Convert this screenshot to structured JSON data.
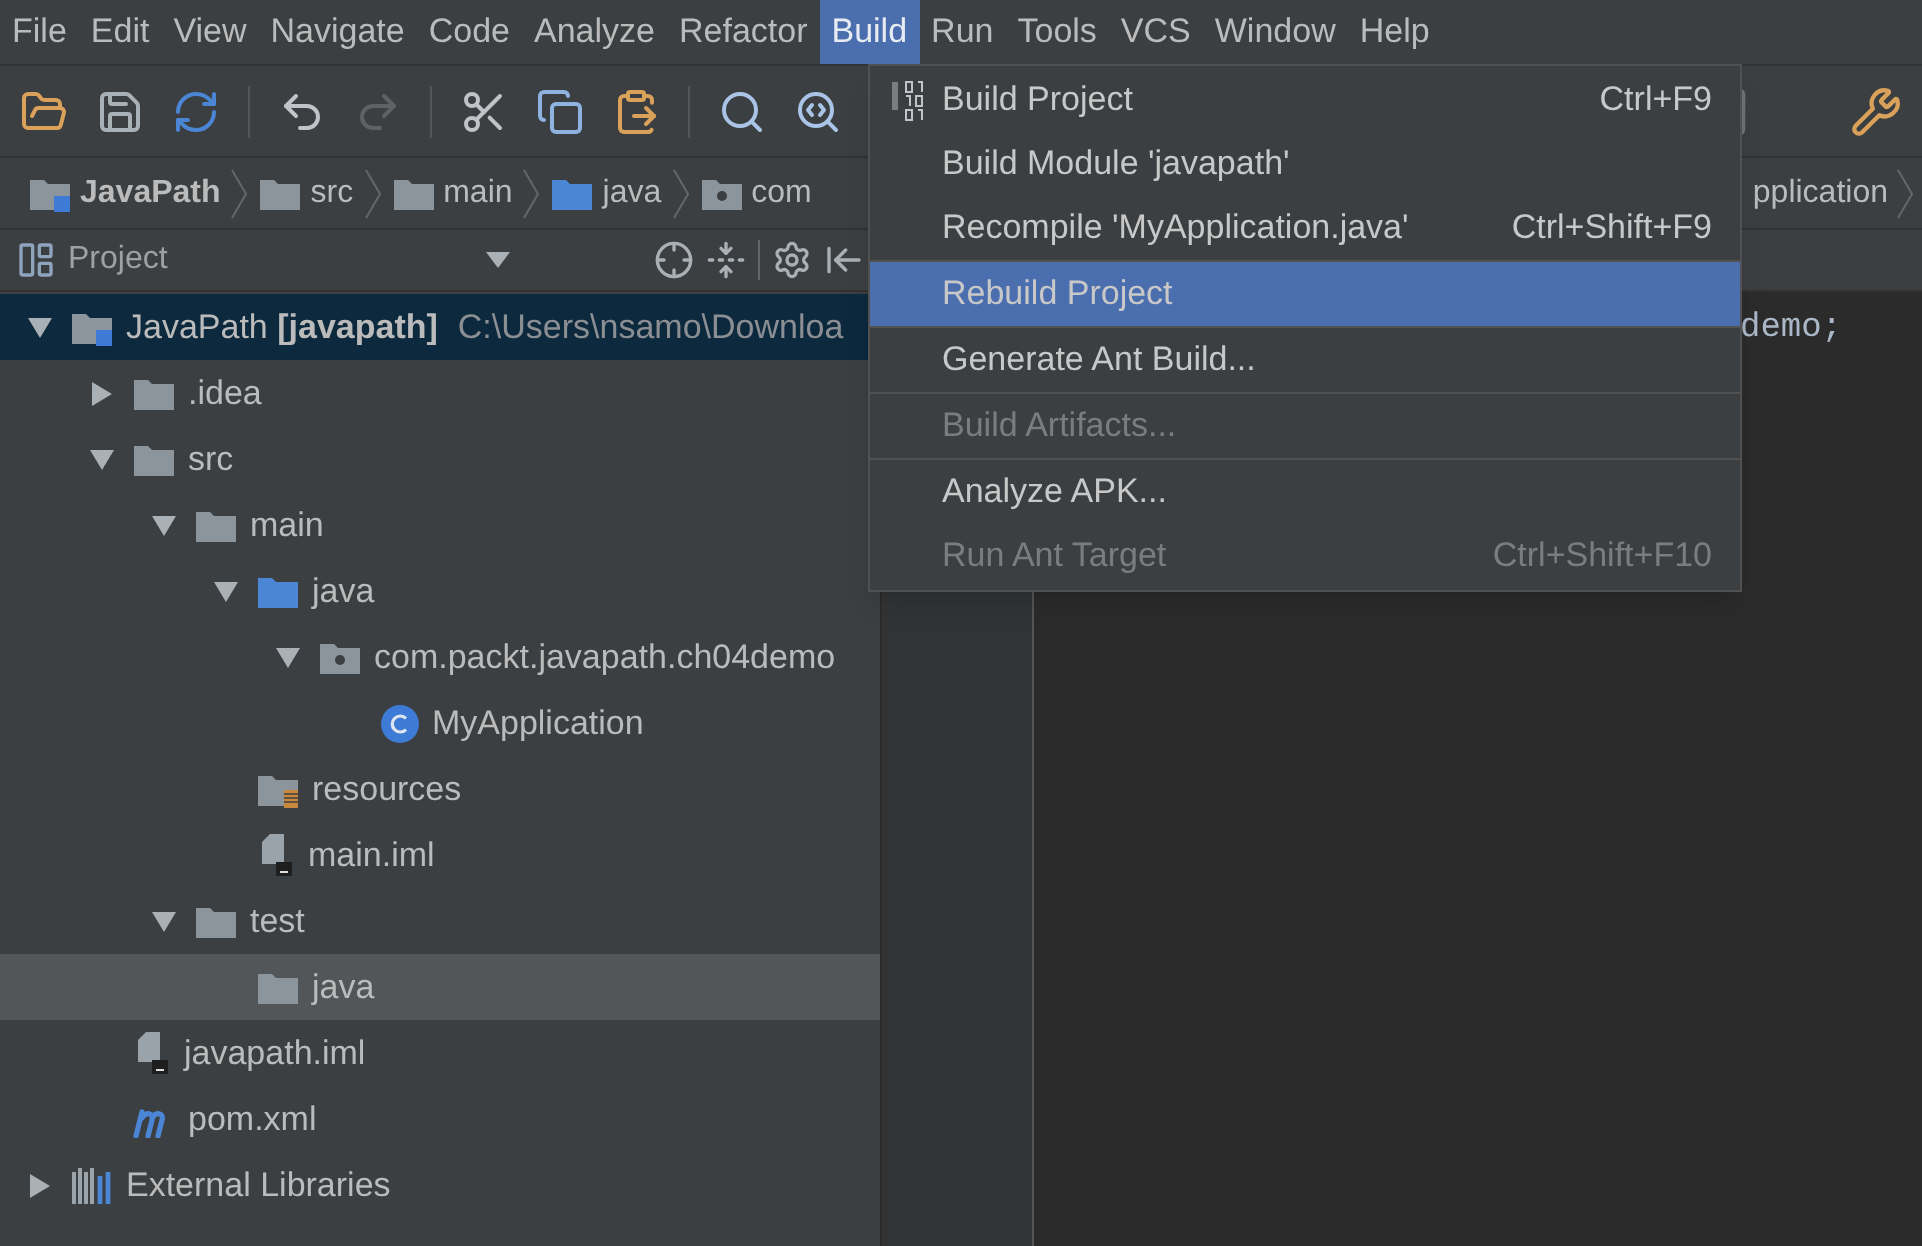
{
  "menu_bar": [
    {
      "label": "File",
      "selected": false
    },
    {
      "label": "Edit",
      "selected": false
    },
    {
      "label": "View",
      "selected": false
    },
    {
      "label": "Navigate",
      "selected": false
    },
    {
      "label": "Code",
      "selected": false
    },
    {
      "label": "Analyze",
      "selected": false
    },
    {
      "label": "Refactor",
      "selected": false
    },
    {
      "label": "Build",
      "selected": true
    },
    {
      "label": "Run",
      "selected": false
    },
    {
      "label": "Tools",
      "selected": false
    },
    {
      "label": "VCS",
      "selected": false
    },
    {
      "label": "Window",
      "selected": false
    },
    {
      "label": "Help",
      "selected": false
    }
  ],
  "breadcrumbs": [
    {
      "label": "JavaPath",
      "kind": "module"
    },
    {
      "label": "src",
      "kind": "folder"
    },
    {
      "label": "main",
      "kind": "folder"
    },
    {
      "label": "java",
      "kind": "source_folder"
    },
    {
      "label": "com",
      "kind": "package"
    }
  ],
  "breadcrumb_tail": "pplication",
  "project_panel": {
    "title": "Project",
    "tree": [
      {
        "label": "JavaPath **[javapath]**",
        "path": "C:\\Users\\nsamo\\Downloa",
        "kind": "module",
        "expanded": true,
        "selected": true,
        "hovered": false,
        "children": [
          {
            "label": ".idea",
            "kind": "folder",
            "expanded": false,
            "selected": false,
            "hovered": false
          },
          {
            "label": "src",
            "kind": "folder",
            "expanded": true,
            "selected": false,
            "hovered": false,
            "children": [
              {
                "label": "main",
                "kind": "folder",
                "expanded": true,
                "selected": false,
                "hovered": false,
                "children": [
                  {
                    "label": "java",
                    "kind": "source_folder",
                    "expanded": true,
                    "selected": false,
                    "hovered": false,
                    "children": [
                      {
                        "label": "com.packt.javapath.ch04demo",
                        "kind": "package",
                        "expanded": true,
                        "selected": false,
                        "hovered": false,
                        "children": [
                          {
                            "label": "MyApplication",
                            "kind": "class",
                            "selected": false,
                            "hovered": false
                          }
                        ]
                      }
                    ]
                  },
                  {
                    "label": "resources",
                    "kind": "resources_folder",
                    "selected": false,
                    "hovered": false
                  },
                  {
                    "label": "main.iml",
                    "kind": "module_file",
                    "selected": false,
                    "hovered": false
                  }
                ]
              },
              {
                "label": "test",
                "kind": "folder",
                "expanded": true,
                "selected": false,
                "hovered": false,
                "children": [
                  {
                    "label": "java",
                    "kind": "folder",
                    "selected": false,
                    "hovered": true
                  }
                ]
              }
            ]
          },
          {
            "label": "javapath.iml",
            "kind": "module_file",
            "selected": false,
            "hovered": false
          },
          {
            "label": "pom.xml",
            "kind": "maven_file",
            "selected": false,
            "hovered": false
          }
        ]
      },
      {
        "label": "External Libraries",
        "kind": "libraries",
        "expanded": false,
        "selected": false,
        "hovered": false
      }
    ]
  },
  "editor": {
    "code_line": "demo;"
  },
  "build_menu": {
    "groups": [
      [
        {
          "label": "Build Project",
          "shortcut": "Ctrl+F9",
          "disabled": false,
          "selected": false,
          "kind": "binary"
        },
        {
          "label": "Build Module 'javapath'",
          "disabled": false,
          "selected": false
        },
        {
          "label": "Recompile 'MyApplication.java'",
          "shortcut": "Ctrl+Shift+F9",
          "disabled": false,
          "selected": false
        }
      ],
      [
        {
          "label": "Rebuild Project",
          "disabled": false,
          "selected": true
        }
      ],
      [
        {
          "label": "Generate Ant Build...",
          "disabled": false,
          "selected": false
        }
      ],
      [
        {
          "label": "Build Artifacts...",
          "disabled": true,
          "selected": false
        }
      ],
      [
        {
          "label": "Analyze APK...",
          "disabled": false,
          "selected": false
        },
        {
          "label": "Run Ant Target",
          "shortcut": "Ctrl+Shift+F10",
          "disabled": true,
          "selected": false
        }
      ]
    ]
  }
}
